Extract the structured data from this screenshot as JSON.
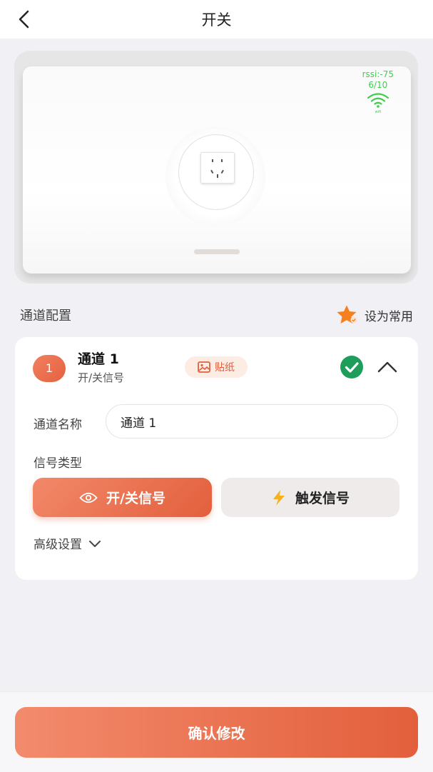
{
  "header": {
    "title": "开关"
  },
  "device": {
    "rssi": "rssi:-75",
    "signal_ratio": "6/10",
    "wifi_label": "wifi"
  },
  "section": {
    "title": "通道配置",
    "favorite_label": "设为常用"
  },
  "channel": {
    "number": "1",
    "name": "通道 1",
    "subtitle": "开/关信号",
    "sticker_label": "贴纸",
    "name_label": "通道名称",
    "name_value": "通道 1",
    "signal_type_label": "信号类型",
    "option_onoff": "开/关信号",
    "option_trigger": "触发信号",
    "advanced_label": "高级设置"
  },
  "footer": {
    "confirm_label": "确认修改"
  },
  "colors": {
    "accent": "#e6613f",
    "success": "#1e9e5a",
    "signal": "#3ecf4e",
    "star": "#f5801f"
  }
}
